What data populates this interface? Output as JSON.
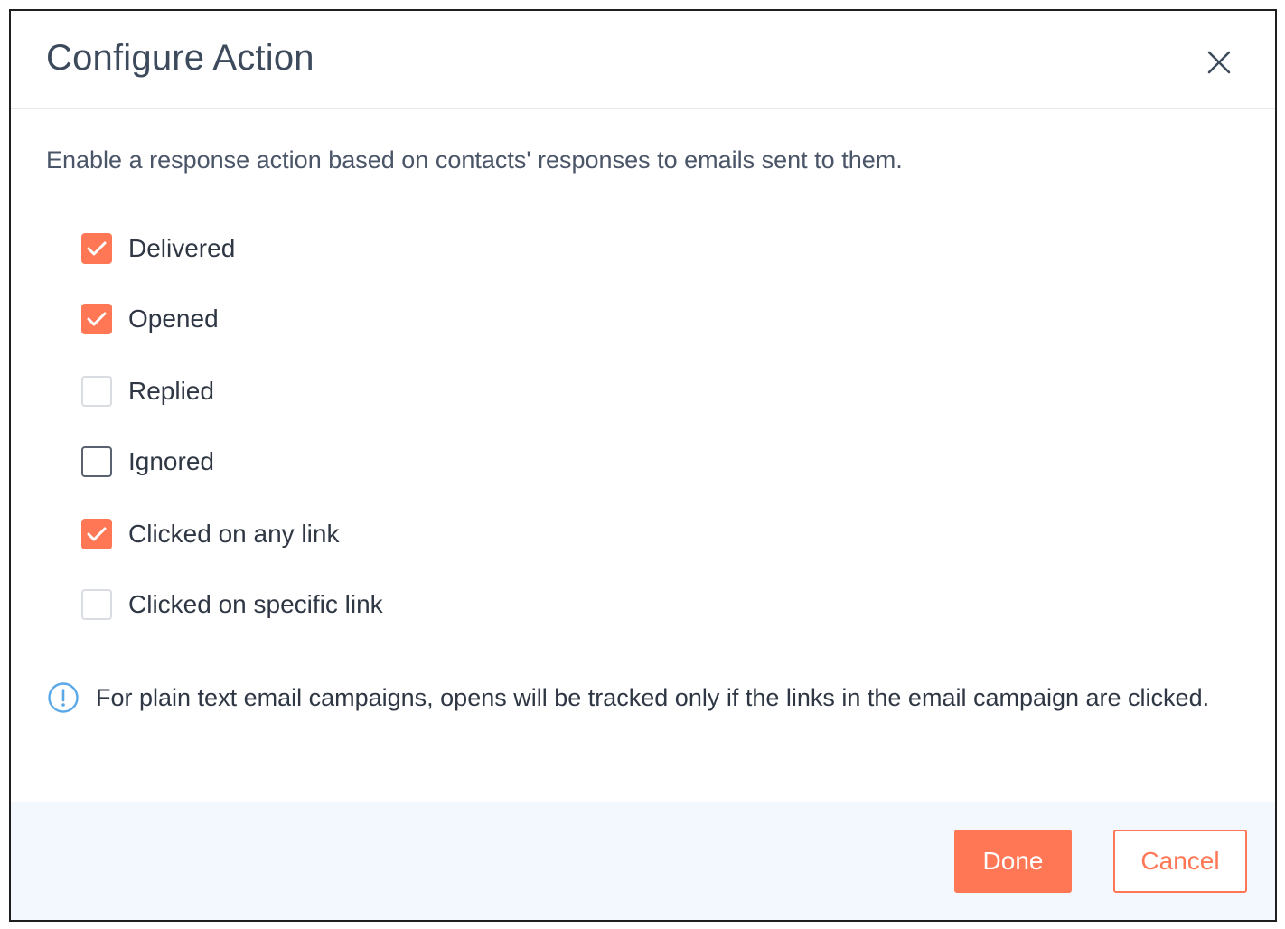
{
  "dialog": {
    "title": "Configure Action",
    "close_icon": "close-icon",
    "description": "Enable a response action based on contacts' responses to emails sent to them."
  },
  "options": [
    {
      "label": "Delivered",
      "checked": true
    },
    {
      "label": "Opened",
      "checked": true
    },
    {
      "label": "Replied",
      "checked": false
    },
    {
      "label": "Ignored",
      "checked": false
    },
    {
      "label": "Clicked on any link",
      "checked": true
    },
    {
      "label": "Clicked on specific link",
      "checked": false
    }
  ],
  "note": {
    "icon": "info-icon",
    "text": "For plain text email campaigns, opens will be tracked only if the links in the email campaign are clicked."
  },
  "footer": {
    "done_label": "Done",
    "cancel_label": "Cancel"
  },
  "colors": {
    "accent": "#ff7754",
    "title_text": "#3d4a5c",
    "footer_bg": "#f2f8fd",
    "info_icon": "#5aa8e8"
  }
}
